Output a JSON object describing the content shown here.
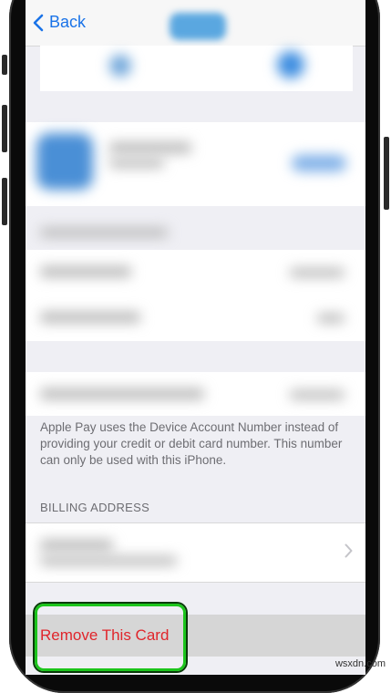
{
  "nav": {
    "back_label": "Back"
  },
  "info": {
    "device_account_note": "Apple Pay uses the Device Account Number instead of providing your credit or debit card number. This number can only be used with this iPhone."
  },
  "billing": {
    "section_header": "BILLING ADDRESS"
  },
  "actions": {
    "remove_card_label": "Remove This Card"
  },
  "watermark": "wsxdn.com",
  "colors": {
    "accent": "#1a73e8",
    "destructive": "#e0252b",
    "highlight": "#1cc51c"
  }
}
